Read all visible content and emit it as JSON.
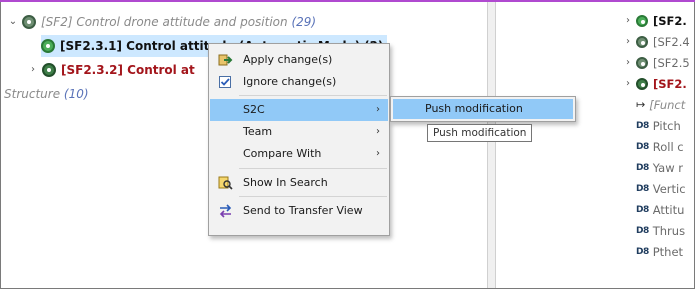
{
  "tree": {
    "rows": [
      {
        "expanded": true,
        "label": "[SF2] Control drone attitude and position",
        "count": "(29)"
      },
      {
        "label": "[SF2.3.1] Control attitude (Automatic Mode)",
        "count": "(2)"
      },
      {
        "expanded": false,
        "label": "[SF2.3.2] Control at"
      },
      {
        "label": "Structure",
        "count": "(10)"
      }
    ]
  },
  "context_menu": {
    "items": [
      {
        "label": "Apply change(s)",
        "icon": "apply-changes-icon"
      },
      {
        "label": "Ignore change(s)",
        "icon": "checkbox-checked-icon"
      },
      {
        "label": "S2C",
        "submenu": true,
        "highlighted": true
      },
      {
        "label": "Team",
        "submenu": true
      },
      {
        "label": "Compare With",
        "submenu": true
      },
      {
        "label": "Show In Search",
        "icon": "show-in-search-icon"
      },
      {
        "label": "Send to Transfer View",
        "icon": "transfer-view-icon"
      }
    ],
    "submenu": {
      "item": "Push modification"
    },
    "tooltip": "Push modification"
  },
  "right_tree": {
    "rows": [
      {
        "label": "[SF2.",
        "style": "bold",
        "icon": "function-circle-icon"
      },
      {
        "label": "[SF2.4",
        "style": "gray",
        "icon": "function-circle-icon"
      },
      {
        "label": "[SF2.5",
        "style": "gray",
        "icon": "function-circle-icon"
      },
      {
        "label": "[SF2.",
        "style": "red",
        "icon": "function-circle-icon"
      },
      {
        "label": "[Funct",
        "style": "func",
        "icon": "functional-chain-icon"
      },
      {
        "label": "Pitch",
        "style": "gray",
        "icon": "db-icon"
      },
      {
        "label": "Roll c",
        "style": "gray",
        "icon": "db-icon"
      },
      {
        "label": "Yaw r",
        "style": "gray",
        "icon": "db-icon"
      },
      {
        "label": "Vertic",
        "style": "gray",
        "icon": "db-icon"
      },
      {
        "label": "Attitu",
        "style": "gray",
        "icon": "db-icon"
      },
      {
        "label": "Thrus",
        "style": "gray",
        "icon": "db-icon"
      },
      {
        "label": "Pthet",
        "style": "gray",
        "icon": "db-icon"
      }
    ],
    "db_glyph": "D8",
    "func_glyph": "↦"
  },
  "glyphs": {
    "expanded": "⌵",
    "collapsed": "›",
    "submenu_arrow": "›"
  }
}
